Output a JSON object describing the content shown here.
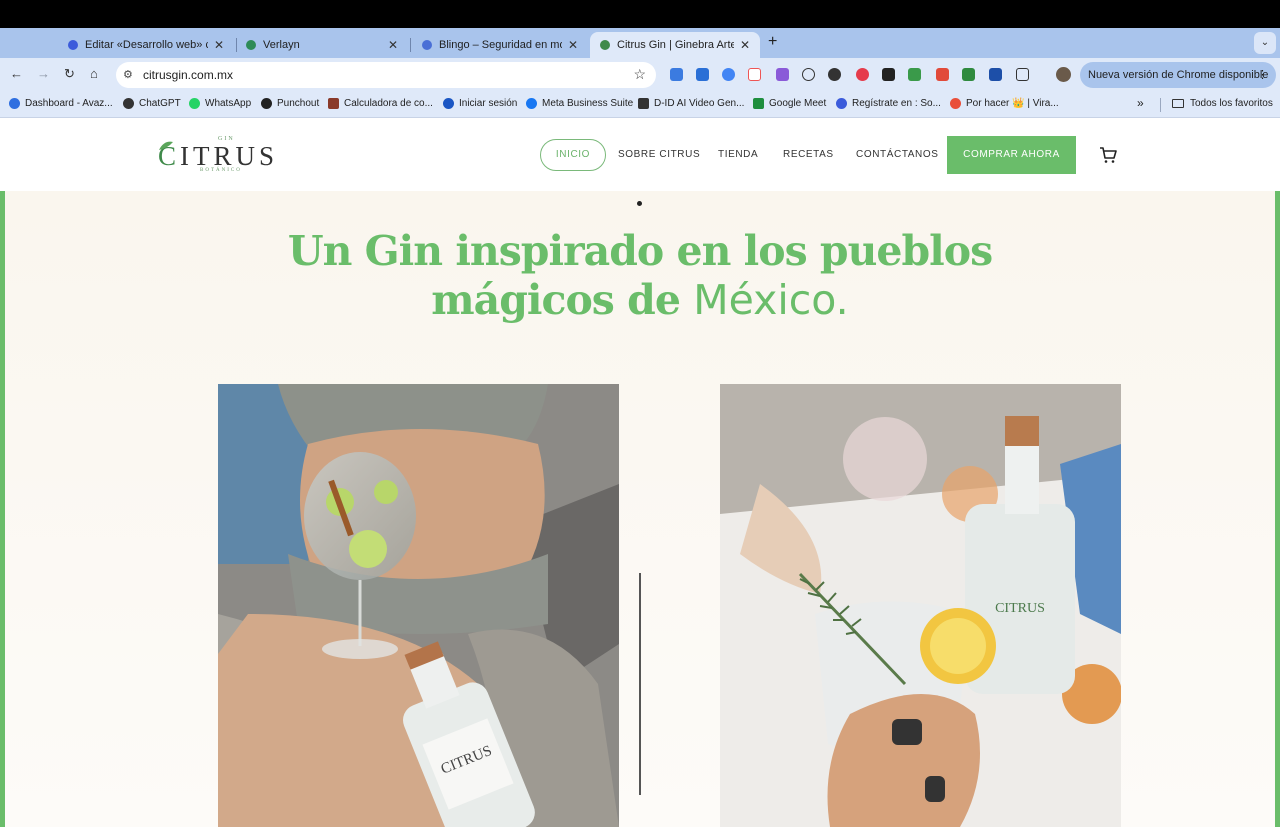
{
  "browser": {
    "tabs": [
      {
        "title": "Editar «Desarrollo web» con E",
        "favicon_color": "#3b5bdb"
      },
      {
        "title": "Verlayn",
        "favicon_color": "#2e8b57"
      },
      {
        "title": "Blingo – Seguridad en movimie",
        "favicon_color": "#4a6fd6"
      },
      {
        "title": "Citrus Gin | Ginebra Artesanal",
        "favicon_color": "#3f8a4a"
      }
    ],
    "new_tab": "+",
    "tab_menu": "⌄",
    "url": "citrusgin.com.mx",
    "update_button": "Nueva versión de Chrome disponible",
    "bookmarks": [
      {
        "label": "Dashboard - Avaz...",
        "color": "#2f6fe0"
      },
      {
        "label": "ChatGPT",
        "color": "#333333"
      },
      {
        "label": "WhatsApp",
        "color": "#25d366"
      },
      {
        "label": "Punchout",
        "color": "#222222"
      },
      {
        "label": "Calculadora de co...",
        "color": "#8a3a2a"
      },
      {
        "label": "Iniciar sesión",
        "color": "#1a56c4"
      },
      {
        "label": "Meta Business Suite",
        "color": "#1877f2"
      },
      {
        "label": "D-ID AI Video Gen...",
        "color": "#333333"
      },
      {
        "label": "Google Meet",
        "color": "#1e8e3e"
      },
      {
        "label": "Regístrate en : So...",
        "color": "#3b5bdb"
      },
      {
        "label": "Por hacer 👑 | Vira...",
        "color": "#e94f3a"
      }
    ],
    "more_bookmarks": "»",
    "all_bookmarks": "Todos los favoritos"
  },
  "site": {
    "logo": {
      "top": "GIN",
      "word_first": "C",
      "word_rest": "ITRUS",
      "bottom": "BOTÁNICO"
    },
    "nav": [
      "INICIO",
      "SOBRE CITRUS",
      "TIENDA",
      "RECETAS",
      "CONTÁCTANOS"
    ],
    "cta": "COMPRAR AHORA",
    "headline_line1": "Un Gin inspirado en los pueblos",
    "headline_line2_bold": "mágicos de",
    "headline_line2_light": "México."
  },
  "colors": {
    "brand_green": "#6abd6a",
    "tab_bar": "#a9c4ec",
    "toolbar": "#dfe9f9",
    "hero_bg": "#faf6ee"
  }
}
